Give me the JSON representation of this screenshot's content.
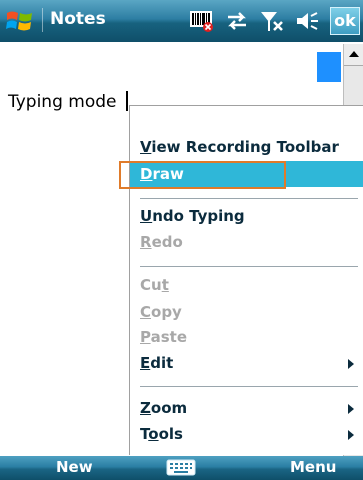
{
  "titlebar": {
    "title": "Notes",
    "ok_label": "ok",
    "icons": [
      "start-logo-icon",
      "barcode-error-icon",
      "sync-arrows-icon",
      "antenna-no-signal-icon",
      "speaker-icon"
    ]
  },
  "content": {
    "text": "Typing mode",
    "pen_color": "#1e90ff"
  },
  "menu": {
    "items": [
      {
        "label": "View Recording Toolbar",
        "underline": "V",
        "rest": "iew Recording Toolbar",
        "enabled": true
      },
      {
        "label": "Draw",
        "underline": "D",
        "rest": "raw",
        "enabled": true,
        "selected": true
      },
      {
        "label": "Undo Typing",
        "underline": "U",
        "rest": "ndo Typing",
        "enabled": true
      },
      {
        "label": "Redo",
        "underline": "R",
        "rest": "edo",
        "enabled": false
      },
      {
        "label": "Cut",
        "pre": "Cu",
        "underline": "t",
        "enabled": false
      },
      {
        "label": "Copy",
        "underline": "C",
        "rest": "opy",
        "enabled": false
      },
      {
        "label": "Paste",
        "underline": "P",
        "rest": "aste",
        "enabled": false
      },
      {
        "label": "Edit",
        "underline": "E",
        "rest": "dit",
        "enabled": true,
        "submenu": true
      },
      {
        "label": "Zoom",
        "underline": "Z",
        "rest": "oom",
        "enabled": true,
        "submenu": true
      },
      {
        "label": "Tools",
        "pre": "T",
        "underline": "o",
        "rest": "ols",
        "enabled": true,
        "submenu": true
      }
    ],
    "highlight_color": "#2fb7d8",
    "focus_outline_color": "#e07b2a"
  },
  "bottombar": {
    "left_softkey": "New",
    "right_softkey": "Menu",
    "center_icon": "keyboard-icon"
  }
}
